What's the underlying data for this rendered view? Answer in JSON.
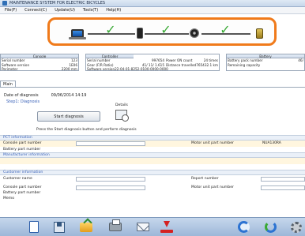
{
  "titlebar": {
    "title": "MAINTENANCE SYSTEM FOR ELECTRIC BICYCLES"
  },
  "menu": [
    {
      "label": "File(F)"
    },
    {
      "label": "Connect(C)"
    },
    {
      "label": "Update(U)"
    },
    {
      "label": "Tools(T)"
    },
    {
      "label": "Help(H)"
    }
  ],
  "status_chain": {
    "accent_color": "#f07a1a",
    "check_color": "#39a935",
    "steps": [
      "laptop-icon",
      "diagnosis-device-icon",
      "drive-unit-icon",
      "battery-icon"
    ],
    "links_ok": [
      true,
      true,
      true
    ]
  },
  "console": {
    "header": "Console",
    "rows": [
      {
        "label": "Serial number",
        "value": "123"
      },
      {
        "label": "Software version",
        "value": "1E06"
      },
      {
        "label": "Perimeter",
        "value": "2200 mm"
      }
    ]
  },
  "controller": {
    "header": "Controller",
    "rows": [
      {
        "label": "Serial number",
        "value": "997654"
      },
      {
        "label": "Gear (F/R Ratio)",
        "value": "41/ 11/ 1.615"
      },
      {
        "label": "Software version",
        "value": "22-04-01-8252-0100-0000-0000"
      }
    ],
    "rows2": [
      {
        "label": "Power ON count",
        "value": "24 times"
      },
      {
        "label": "Distance travelled",
        "value": "765432.1 km"
      }
    ]
  },
  "battery": {
    "header": "Battery",
    "rows": [
      {
        "label": "Battery pack number",
        "value": "46/"
      },
      {
        "label": "Remaining capacity",
        "value": ""
      }
    ]
  },
  "tabs": [
    {
      "label": "Main"
    }
  ],
  "main": {
    "date_label": "Date of diagnosis",
    "date_value": "09/06/2014 14:19",
    "step_label": "Step1: Diagnosis",
    "details_label": "Details",
    "start_button": "Start diagnosis",
    "instruction": "Press the Start diagnosis button and perform diagnosis"
  },
  "pct": {
    "header": "PCT information",
    "console_part_label": "Console part number",
    "console_part_value": "",
    "motor_unit_label": "Motor unit part number",
    "motor_unit_value": "NUA130RA",
    "battery_part_label": "Battery part number",
    "battery_part_value": ""
  },
  "manufacturer": {
    "header": "Manufacturer information"
  },
  "customer": {
    "header": "Customer information",
    "name_label": "Customer name",
    "name_value": "",
    "report_label": "Report number",
    "report_value": "",
    "console_part_label": "Console part number",
    "console_part_value": "",
    "motor_unit_label": "Motor unit part number",
    "motor_unit_value": "",
    "battery_part_label": "Battery part number",
    "memo_label": "Memo"
  },
  "toolbar": {
    "icons": [
      "new-document-icon",
      "save-icon",
      "open-folder-icon",
      "print-icon",
      "mail-icon",
      "upload-icon",
      "refresh-icon",
      "sync-icon",
      "settings-icon"
    ]
  }
}
